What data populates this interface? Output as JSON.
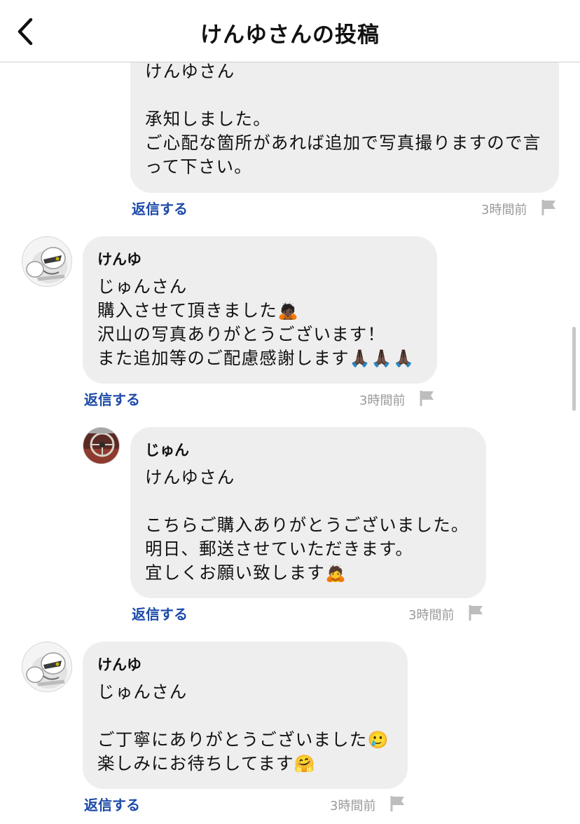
{
  "header": {
    "title": "けんゆさんの投稿"
  },
  "comments": [
    {
      "text": "けんゆさん\n\n承知しました。\nご心配な箇所があれば追加で写真撮りますので言\nって下さい。",
      "reply_label": "返信する",
      "time": "3時間前"
    },
    {
      "author": "けんゆ",
      "text": "じゅんさん\n購入させて頂きました",
      "emoji_1": "🙇🏿",
      "text_2": "沢山の写真ありがとうございます！\nまた追加等のご配慮感謝します",
      "emoji_2": "🙏🏿🙏🏿🙏🏿",
      "reply_label": "返信する",
      "time": "3時間前"
    },
    {
      "author": "じゅん",
      "text": "けんゆさん\n\nこちらご購入ありがとうございました。\n明日、郵送させていただきます。\n宜しくお願い致します",
      "emoji": "🙇",
      "reply_label": "返信する",
      "time": "3時間前"
    },
    {
      "author": "けんゆ",
      "text": "じゅんさん\n\nご丁寧にありがとうございました",
      "emoji_1": "🥲",
      "text_2": "楽しみにお待ちしてます",
      "emoji_2": "🤗",
      "reply_label": "返信する",
      "time": "3時間前"
    }
  ]
}
